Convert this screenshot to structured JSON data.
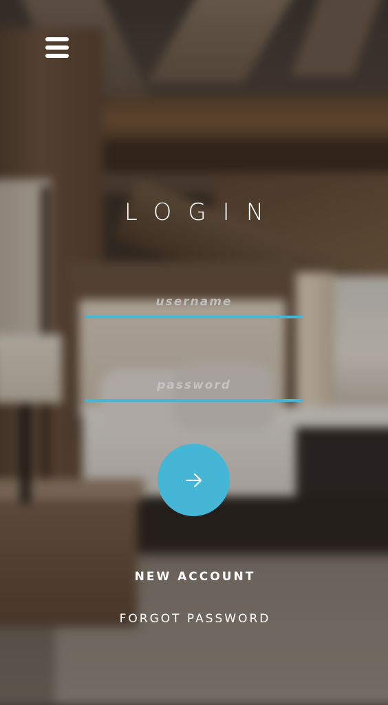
{
  "header": {
    "menu_icon": "hamburger-menu-icon"
  },
  "login": {
    "title": "LOGIN",
    "username_placeholder": "username",
    "password_placeholder": "password",
    "submit_icon": "arrow-right-icon",
    "new_account_label": "NEW ACCOUNT",
    "forgot_password_label": "FORGOT PASSWORD"
  },
  "theme": {
    "accent": "#45b6d6",
    "text": "#ffffff"
  }
}
